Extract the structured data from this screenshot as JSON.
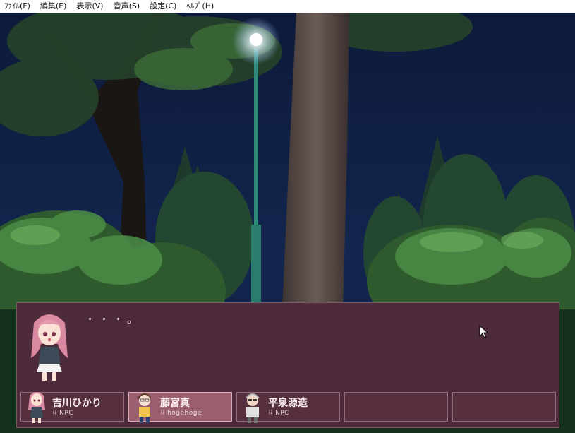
{
  "menubar": {
    "items": [
      "ﾌｧｲﾙ(F)",
      "編集(E)",
      "表示(V)",
      "音声(S)",
      "設定(C)",
      "ﾍﾙﾌﾟ(H)"
    ]
  },
  "message": {
    "text": "・・・。"
  },
  "party": [
    {
      "name": "吉川ひかり",
      "sub": "NPC",
      "active": false
    },
    {
      "name": "藤宮真",
      "sub": "hogehoge",
      "active": true
    },
    {
      "name": "平泉源造",
      "sub": "NPC",
      "active": false
    },
    {
      "name": "",
      "sub": "",
      "active": false
    },
    {
      "name": "",
      "sub": "",
      "active": false
    }
  ],
  "colors": {
    "panel": "#4e2b3a",
    "slot_active": "#9b6070",
    "night_sky": "#0b1530"
  },
  "icons": {
    "speaker": "portrait-girl-pink-hair",
    "cursor": "mouse-pointer"
  }
}
